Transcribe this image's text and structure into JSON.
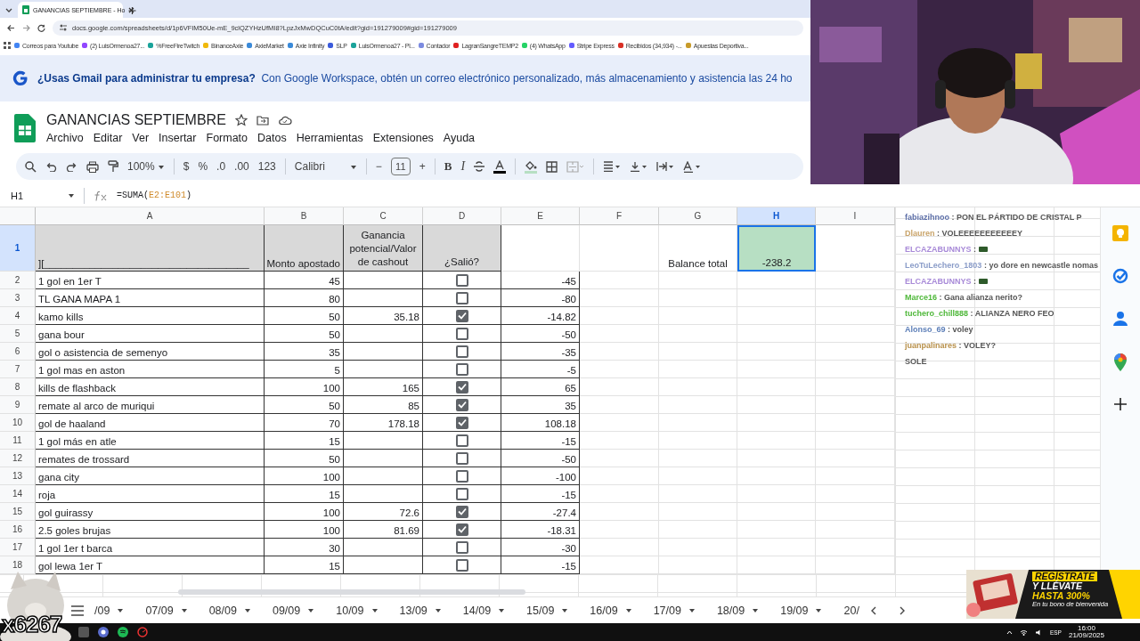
{
  "browser": {
    "tab_title": "GANANCIAS SEPTIEMBRE - Ho",
    "url": "docs.google.com/spreadsheets/d/1p6VFIM50Ue-mE_9clQZYHzUfMI8?LpzJxMwDQCuC0tA/edit?gid=191279009#gid=191279009",
    "bookmarks": [
      {
        "label": "Correos para Youtube",
        "color": "#4285f4"
      },
      {
        "label": "(2) LuisOrmenoa27...",
        "color": "#9146ff"
      },
      {
        "label": "%FreeFireTwitch",
        "color": "#1aa39a"
      },
      {
        "label": "BinanceAxie",
        "color": "#f0b90b"
      },
      {
        "label": "AxieMarket",
        "color": "#3a8ad8"
      },
      {
        "label": "Axie Infinity",
        "color": "#3a8ad8"
      },
      {
        "label": "SLP",
        "color": "#3b5bdb"
      },
      {
        "label": "LuisOrmenoa27 - Pl...",
        "color": "#1aa39a"
      },
      {
        "label": "Contador",
        "color": "#7c8be0"
      },
      {
        "label": "LagranSangreTEMP2",
        "color": "#e02020"
      },
      {
        "label": "(4) WhatsApp",
        "color": "#25d366"
      },
      {
        "label": "Stripe Express",
        "color": "#635bff"
      },
      {
        "label": "Recibidos (34,934) -...",
        "color": "#d93025"
      },
      {
        "label": "Apuestas Deportiva...",
        "color": "#c89b2a"
      }
    ]
  },
  "banner": {
    "title": "¿Usas Gmail para administrar tu empresa?",
    "text": "Con Google Workspace, obtén un correo electrónico personalizado, más almacenamiento y asistencia las 24 ho"
  },
  "document": {
    "title": "GANANCIAS SEPTIEMBRE",
    "menu": [
      "Archivo",
      "Editar",
      "Ver",
      "Insertar",
      "Formato",
      "Datos",
      "Herramientas",
      "Extensiones",
      "Ayuda"
    ]
  },
  "toolbar": {
    "zoom": "100%",
    "formats": [
      "$",
      "%",
      ".0",
      ".00",
      "123"
    ],
    "font": "Calibri",
    "minus": "−",
    "font_size": "11",
    "plus": "+",
    "bold": "B",
    "italic": "I"
  },
  "formula_bar": {
    "cell": "H1",
    "formula": [
      {
        "text": "=SUMA(",
        "kind": "plain"
      },
      {
        "text": "E2:E101",
        "kind": "range"
      },
      {
        "text": ")",
        "kind": "plain"
      }
    ]
  },
  "sheet": {
    "columns": [
      {
        "label": "A",
        "selected": false
      },
      {
        "label": "B",
        "selected": false
      },
      {
        "label": "C",
        "selected": false
      },
      {
        "label": "D",
        "selected": false
      },
      {
        "label": "E",
        "selected": false
      },
      {
        "label": "F",
        "selected": false
      },
      {
        "label": "G",
        "selected": false
      },
      {
        "label": "H",
        "selected": true
      },
      {
        "label": "I",
        "selected": false
      }
    ],
    "header_row": {
      "number": "1",
      "selected": true,
      "a": "][____________________________________",
      "b": "Monto apostado",
      "c": "Ganancia potencial/Valor de cashout",
      "d": "¿Salió?",
      "g": "Balance total",
      "h": "-238.2",
      "h_selected": true
    },
    "rows": [
      {
        "number": "2",
        "bet": "1 gol en 1er T",
        "amount": "45",
        "checked": false,
        "result": "-45"
      },
      {
        "number": "3",
        "bet": "TL GANA MAPA 1",
        "amount": "80",
        "checked": false,
        "result": "-80"
      },
      {
        "number": "4",
        "bet": "kamo kills",
        "amount": "50",
        "cashout": "35.18",
        "checked": true,
        "result": "-14.82"
      },
      {
        "number": "5",
        "bet": "gana bour",
        "amount": "50",
        "checked": false,
        "result": "-50"
      },
      {
        "number": "6",
        "bet": "gol o asistencia de semenyo",
        "amount": "35",
        "checked": false,
        "result": "-35"
      },
      {
        "number": "7",
        "bet": "1 gol mas en aston",
        "amount": "5",
        "checked": false,
        "result": "-5"
      },
      {
        "number": "8",
        "bet": "kills de flashback",
        "amount": "100",
        "cashout": "165",
        "checked": true,
        "result": "65"
      },
      {
        "number": "9",
        "bet": "remate al arco de muriqui",
        "amount": "50",
        "cashout": "85",
        "checked": true,
        "result": "35"
      },
      {
        "number": "10",
        "bet": "gol de haaland",
        "amount": "70",
        "cashout": "178.18",
        "checked": true,
        "result": "108.18"
      },
      {
        "number": "11",
        "bet": "1 gol más en atle",
        "amount": "15",
        "checked": false,
        "result": "-15"
      },
      {
        "number": "12",
        "bet": "remates de trossard",
        "amount": "50",
        "checked": false,
        "result": "-50"
      },
      {
        "number": "13",
        "bet": "gana city",
        "amount": "100",
        "checked": false,
        "result": "-100"
      },
      {
        "number": "14",
        "bet": "roja",
        "amount": "15",
        "checked": false,
        "result": "-15"
      },
      {
        "number": "15",
        "bet": "gol guirassy",
        "amount": "100",
        "cashout": "72.6",
        "checked": true,
        "result": "-27.4"
      },
      {
        "number": "16",
        "bet": "2.5 goles brujas",
        "amount": "100",
        "cashout": "81.69",
        "checked": true,
        "result": "-18.31"
      },
      {
        "number": "17",
        "bet": "1 gol 1er t barca",
        "amount": "30",
        "checked": false,
        "result": "-30"
      },
      {
        "number": "18",
        "bet": "gol lewa 1er T",
        "amount": "15",
        "checked": false,
        "result": "-15"
      }
    ],
    "tabs": [
      {
        "label": "/09",
        "selected": false
      },
      {
        "label": "07/09",
        "selected": false
      },
      {
        "label": "08/09",
        "selected": false
      },
      {
        "label": "09/09",
        "selected": false
      },
      {
        "label": "10/09",
        "selected": false
      },
      {
        "label": "13/09",
        "selected": false
      },
      {
        "label": "14/09",
        "selected": false
      },
      {
        "label": "15/09",
        "selected": false
      },
      {
        "label": "16/09",
        "selected": false
      },
      {
        "label": "17/09",
        "selected": false
      },
      {
        "label": "18/09",
        "selected": false
      },
      {
        "label": "19/09",
        "selected": false
      },
      {
        "label": "20/",
        "selected": false
      }
    ]
  },
  "chat": [
    {
      "user": "fabiazihnoo",
      "color": "#5d6fa8",
      "kind": "text",
      "separator": ":",
      "message": "PON EL PÁRTIDO DE CRISTAL P"
    },
    {
      "user": "Dlauren",
      "color": "#c9a46a",
      "kind": "text",
      "separator": ":",
      "message": "VOLEEEEEEEEEEEY"
    },
    {
      "user": "ELCAZABUNNYS",
      "color": "#a88ad8",
      "kind": "emote",
      "separator": ":"
    },
    {
      "user": "LeoTuLechero_1803",
      "color": "#8a9cc8",
      "kind": "text",
      "separator": ":",
      "message": "yo dore en newcastle nomas"
    },
    {
      "user": "ELCAZABUNNYS",
      "color": "#a88ad8",
      "kind": "emote",
      "separator": ":"
    },
    {
      "user": "Marce16",
      "color": "#4fb83a",
      "kind": "text",
      "separator": ":",
      "message": "Gana alianza nerito?"
    },
    {
      "user": "tuchero_chill888",
      "color": "#4fb83a",
      "kind": "text",
      "separator": ":",
      "message": "ALIANZA NERO FEO"
    },
    {
      "user": "Alonso_69",
      "color": "#5d7fb8",
      "kind": "text",
      "separator": ":",
      "message": "voley"
    },
    {
      "user": "juanpalinares",
      "color": "#b8904a",
      "kind": "text",
      "separator": ":",
      "message": "VOLEY?"
    },
    {
      "kind": "notice",
      "message": "SOLE"
    }
  ],
  "stream": {
    "counter": "x6267",
    "ad": {
      "line1": "REGÍSTRATE",
      "line2": "Y LLÉVATE",
      "line3": "HASTA 300%",
      "line4": "En tu bono de bienvenida"
    }
  },
  "taskbar": {
    "language": "ESP",
    "time": "16:00",
    "date": "21/09/2025"
  }
}
